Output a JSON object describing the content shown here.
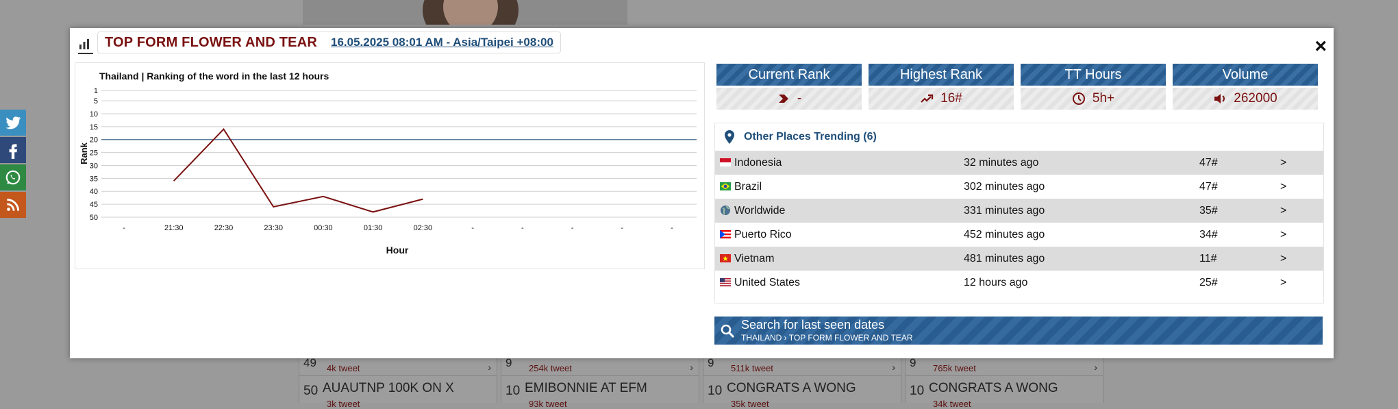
{
  "modal": {
    "title": "TOP FORM FLOWER AND TEAR",
    "date_link": "16.05.2025 08:01 AM - Asia/Taipei +08:00",
    "close_label": "×"
  },
  "chart_data": {
    "type": "line",
    "title": "Thailand  |  Ranking of the word in the last 12 hours",
    "xlabel": "Hour",
    "ylabel": "Rank",
    "categories": [
      "-",
      "21:30",
      "22:30",
      "23:30",
      "00:30",
      "01:30",
      "02:30",
      "-",
      "-",
      "-",
      "-",
      "-"
    ],
    "y_ticks": [
      1,
      5,
      10,
      15,
      20,
      25,
      30,
      35,
      40,
      45,
      50
    ],
    "ylim": [
      50,
      1
    ],
    "y_reversed": true,
    "reference_line": 20,
    "series": [
      {
        "values": [
          null,
          36,
          16,
          46,
          42,
          48,
          43,
          null,
          null,
          null,
          null,
          null
        ],
        "color": "#7a1010"
      }
    ],
    "grid": true
  },
  "stats": [
    {
      "label": "Current Rank",
      "value": "-",
      "icon": "chevron-right-icon"
    },
    {
      "label": "Highest Rank",
      "value": "16#",
      "icon": "trending-up-icon"
    },
    {
      "label": "TT Hours",
      "value": "5h+",
      "icon": "clock-icon"
    },
    {
      "label": "Volume",
      "value": "262000",
      "icon": "speaker-icon"
    }
  ],
  "places": {
    "title": "Other Places Trending (6)",
    "rows": [
      {
        "country": "Indonesia",
        "ago": "32 minutes ago",
        "rank": "47#",
        "go": ">"
      },
      {
        "country": "Brazil",
        "ago": "302 minutes ago",
        "rank": "47#",
        "go": ">"
      },
      {
        "country": "Worldwide",
        "ago": "331 minutes ago",
        "rank": "35#",
        "go": ">"
      },
      {
        "country": "Puerto Rico",
        "ago": "452 minutes ago",
        "rank": "34#",
        "go": ">"
      },
      {
        "country": "Vietnam",
        "ago": "481 minutes ago",
        "rank": "11#",
        "go": ">"
      },
      {
        "country": "United States",
        "ago": "12 hours ago",
        "rank": "25#",
        "go": ">"
      }
    ]
  },
  "search": {
    "title": "Search for last seen dates",
    "crumb": "THAILAND › TOP FORM FLOWER AND TEAR"
  },
  "background": {
    "cols": [
      {
        "top_num": "49",
        "top_tweet": "4k tweet",
        "num": "50",
        "text": "AUAUTNP 100K ON X",
        "sub": "3k tweet"
      },
      {
        "top_num": "9",
        "top_tweet": "254k tweet",
        "num": "10",
        "text": "EMIBONNIE AT EFM",
        "sub": "93k tweet"
      },
      {
        "top_num": "9",
        "top_tweet": "511k tweet",
        "num": "10",
        "text": "CONGRATS A WONG",
        "sub": "35k tweet"
      },
      {
        "top_num": "9",
        "top_tweet": "765k tweet",
        "num": "10",
        "text": "CONGRATS A WONG",
        "sub": "34k tweet"
      }
    ],
    "arrow": "›"
  }
}
